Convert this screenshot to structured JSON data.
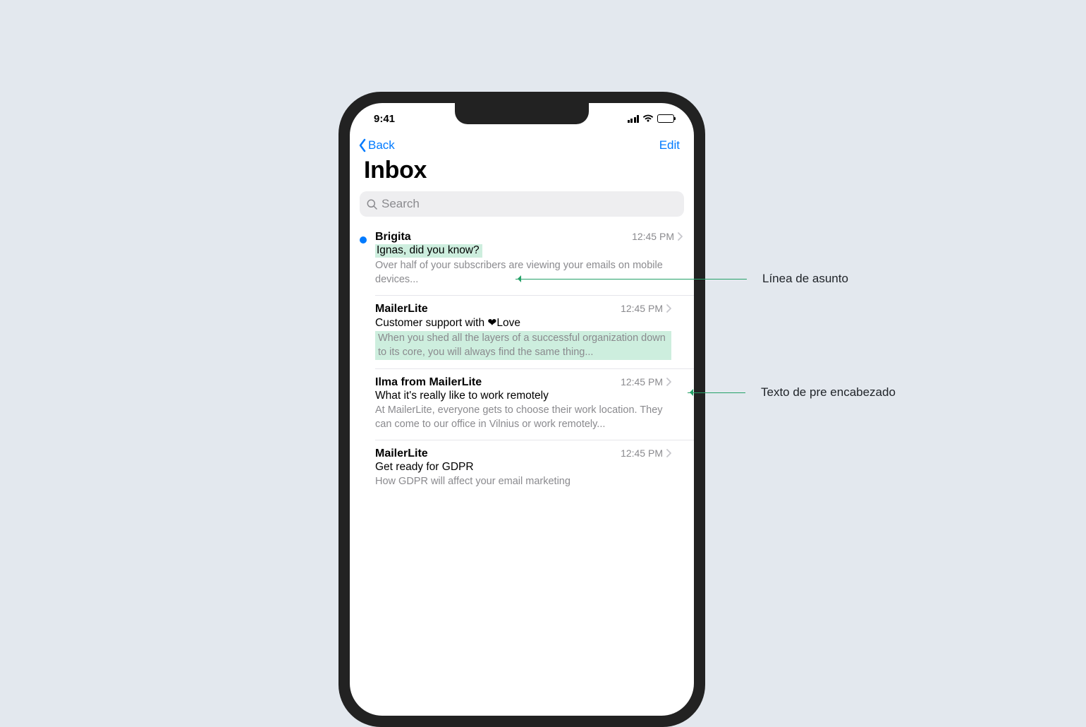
{
  "statusBar": {
    "time": "9:41"
  },
  "nav": {
    "back": "Back",
    "edit": "Edit"
  },
  "title": "Inbox",
  "search": {
    "placeholder": "Search"
  },
  "messages": [
    {
      "sender": "Brigita",
      "time": "12:45 PM",
      "subject": "Ignas, did you know?",
      "preview": "Over half of your subscribers are viewing your emails on mobile devices...",
      "unread": true,
      "highlight": "subject"
    },
    {
      "sender": "MailerLite",
      "time": "12:45 PM",
      "subject": "Customer support with ❤Love",
      "preview": "When you shed all the layers of a successful organization down to its core, you will always find the same thing...",
      "unread": false,
      "highlight": "preview"
    },
    {
      "sender": "Ilma from MailerLite",
      "time": "12:45 PM",
      "subject": "What it's really like to work remotely",
      "preview": "At MailerLite, everyone gets to choose their work location. They can come to our office in Vilnius or work remotely...",
      "unread": false,
      "highlight": "none"
    },
    {
      "sender": "MailerLite",
      "time": "12:45 PM",
      "subject": "Get ready for GDPR",
      "preview": "How GDPR will affect your email marketing",
      "unread": false,
      "highlight": "none"
    }
  ],
  "annotations": {
    "subjectLine": "Línea de asunto",
    "preheaderText": "Texto de pre encabezado"
  }
}
